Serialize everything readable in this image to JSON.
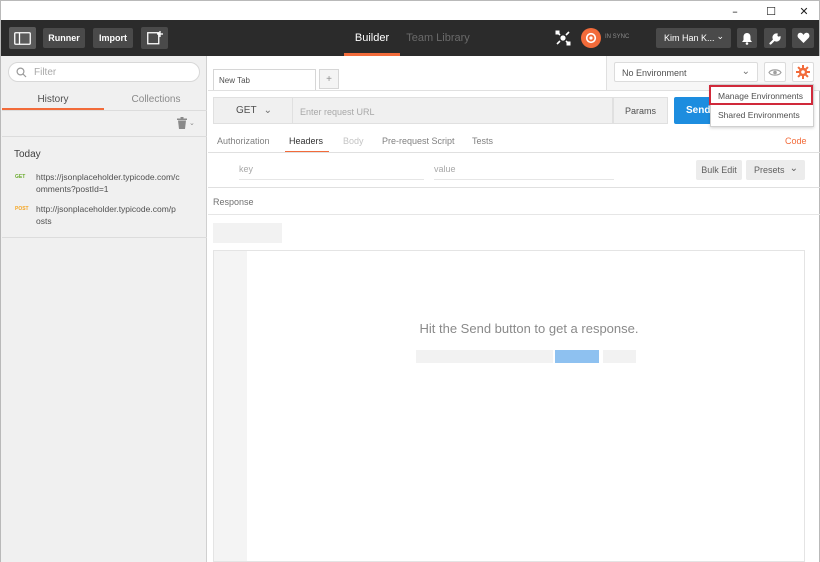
{
  "window": {
    "controls": {
      "minimize": "–",
      "maximize": "☐",
      "close": "✕"
    }
  },
  "header": {
    "runner": "Runner",
    "import": "Import",
    "tabs": {
      "builder": "Builder",
      "team_library": "Team Library"
    },
    "sync": "IN SYNC",
    "user": "Kim Han K...",
    "colors": {
      "bg": "#2b2b2b",
      "accent": "#f26b3a"
    }
  },
  "sidebar": {
    "filter_placeholder": "Filter",
    "tabs": {
      "history": "History",
      "collections": "Collections"
    },
    "group": "Today",
    "items": [
      {
        "method": "GET",
        "url_line1": "https://jsonplaceholder.typicode.com/c",
        "url_line2": "omments?postId=1"
      },
      {
        "method": "POST",
        "url_line1": "http://jsonplaceholder.typicode.com/p",
        "url_line2": "osts"
      }
    ]
  },
  "tabs": {
    "active": "New Tab",
    "add": "+"
  },
  "environment": {
    "selected": "No Environment",
    "menu": {
      "manage": "Manage Environments",
      "shared": "Shared Environments"
    }
  },
  "request": {
    "method": "GET",
    "url_placeholder": "Enter request URL",
    "params": "Params",
    "send": "Send"
  },
  "subtabs": {
    "authorization": "Authorization",
    "headers": "Headers",
    "body": "Body",
    "prerequest": "Pre-request Script",
    "tests": "Tests",
    "code": "Code"
  },
  "headers_editor": {
    "key_placeholder": "key",
    "value_placeholder": "value",
    "bulk_edit": "Bulk Edit",
    "presets": "Presets"
  },
  "response": {
    "label": "Response",
    "empty_message": "Hit the Send button to get a response."
  }
}
